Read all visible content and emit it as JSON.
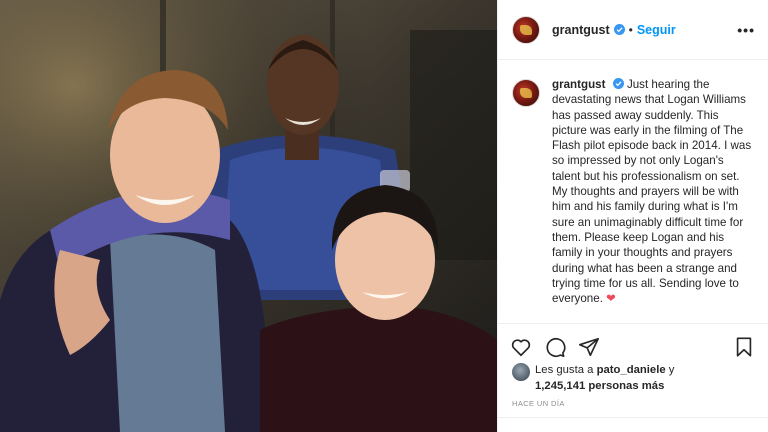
{
  "post": {
    "username": "grantgust",
    "follow_label": "Seguir",
    "separator": "•",
    "more_label": "•••",
    "caption": "Just hearing the devastating news that Logan Williams has passed away suddenly. This picture was early in the filming of The Flash pilot episode back in 2014. I was so impressed by not only Logan's talent but his professionalism on set. My thoughts and prayers will be with him and his family during what is I'm sure an unimaginably difficult time for them. Please keep Logan and his family in your thoughts and prayers during what has been a strange and trying time for us all. Sending love to everyone.",
    "caption_emoji": "❤",
    "likes_prefix": "Les gusta a",
    "likes_user": "pato_daniele",
    "likes_conjunction": "y",
    "likes_count": "1,245,141 personas más",
    "timestamp": "HACE UN DÍA"
  },
  "icons": {
    "verified": "verified-badge-icon",
    "like": "heart-outline-icon",
    "comment": "comment-bubble-icon",
    "share": "paper-plane-icon",
    "save": "bookmark-icon",
    "more": "more-options-icon"
  },
  "colors": {
    "link_blue": "#0095f6",
    "heart_red": "#ed4956",
    "muted": "#8e8e8e",
    "text": "#262626"
  }
}
